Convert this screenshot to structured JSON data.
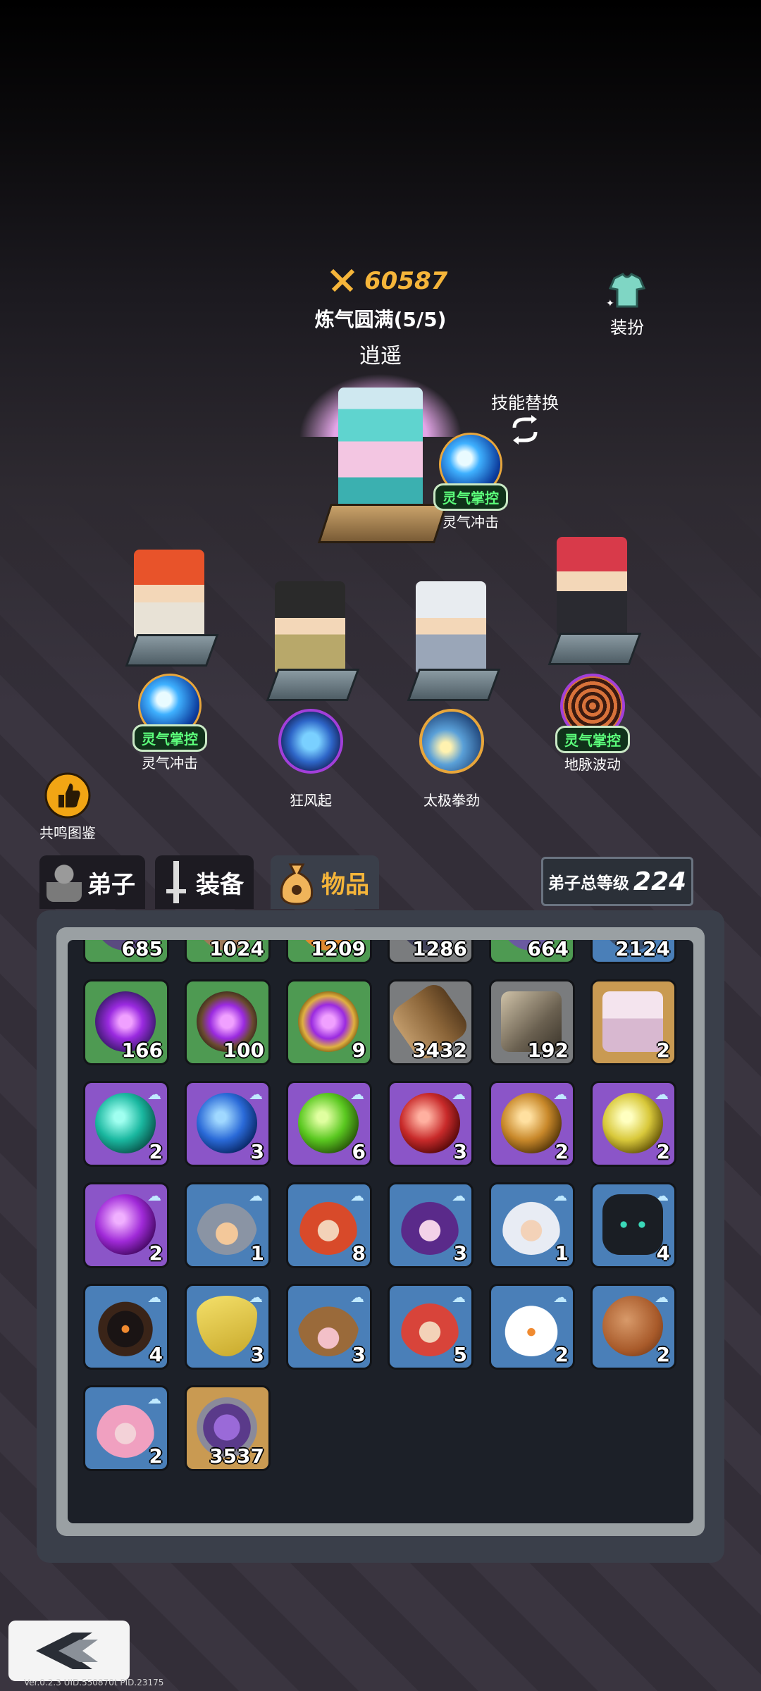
{
  "hero": {
    "power": "60587",
    "realm": "炼气圆满(5/5)",
    "name": "逍遥",
    "dress_label": "装扮",
    "skill_swap_label": "技能替换",
    "skill": {
      "badge": "灵气掌控",
      "name": "灵气冲击",
      "icon": "energy-orb-icon"
    }
  },
  "disciples": [
    {
      "skill_badge": "灵气掌控",
      "skill_name": "灵气冲击",
      "icon": "energy-orb-icon"
    },
    {
      "skill_badge": "",
      "skill_name": "狂风起",
      "icon": "tornado-icon"
    },
    {
      "skill_badge": "",
      "skill_name": "太极拳劲",
      "icon": "taiji-fist-icon"
    },
    {
      "skill_badge": "灵气掌控",
      "skill_name": "地脉波动",
      "icon": "earth-pulse-icon"
    }
  ],
  "codex_label": "共鸣图鉴",
  "tabs": [
    {
      "label": "弟子",
      "icon": "disciple-icon",
      "active": false
    },
    {
      "label": "装备",
      "icon": "sword-icon",
      "active": false
    },
    {
      "label": "物品",
      "icon": "bag-icon",
      "active": true
    }
  ],
  "level": {
    "label": "弟子总等级",
    "value": "224"
  },
  "inventory": {
    "row0": [
      "685",
      "1024",
      "1209",
      "1286",
      "664",
      "2124"
    ],
    "row1": [
      {
        "count": "166",
        "rarity": "green",
        "icon": "purple-orb-icon"
      },
      {
        "count": "100",
        "rarity": "green",
        "icon": "purple-orb-nest-icon"
      },
      {
        "count": "9",
        "rarity": "green",
        "icon": "purple-orb-gold-icon"
      },
      {
        "count": "3432",
        "rarity": "gray",
        "icon": "wood-log-icon"
      },
      {
        "count": "192",
        "rarity": "gray",
        "icon": "stone-icon"
      },
      {
        "count": "2",
        "rarity": "gold",
        "icon": "treasure-chest-icon"
      }
    ],
    "row2": [
      {
        "count": "2",
        "rarity": "purple",
        "icon": "teal-gourd-icon"
      },
      {
        "count": "3",
        "rarity": "purple",
        "icon": "blue-gourd-icon"
      },
      {
        "count": "6",
        "rarity": "purple",
        "icon": "green-gourd-icon"
      },
      {
        "count": "3",
        "rarity": "purple",
        "icon": "red-gourd-icon"
      },
      {
        "count": "2",
        "rarity": "purple",
        "icon": "amber-gourd-icon"
      },
      {
        "count": "2",
        "rarity": "purple",
        "icon": "yellow-gourd-icon"
      }
    ],
    "row3": [
      {
        "count": "2",
        "rarity": "purple",
        "icon": "violet-gourd-icon"
      },
      {
        "count": "1",
        "rarity": "blue",
        "icon": "hooded-disciple-icon"
      },
      {
        "count": "8",
        "rarity": "blue",
        "icon": "red-dragon-girl-icon"
      },
      {
        "count": "3",
        "rarity": "blue",
        "icon": "purple-hair-girl-icon"
      },
      {
        "count": "1",
        "rarity": "blue",
        "icon": "white-hair-boy-icon"
      },
      {
        "count": "4",
        "rarity": "blue",
        "icon": "shadow-creature-icon"
      }
    ],
    "row4": [
      {
        "count": "4",
        "rarity": "blue",
        "icon": "dark-hood-icon"
      },
      {
        "count": "3",
        "rarity": "blue",
        "icon": "banana-icon"
      },
      {
        "count": "3",
        "rarity": "blue",
        "icon": "witch-hat-icon"
      },
      {
        "count": "5",
        "rarity": "blue",
        "icon": "red-hair-girl-icon"
      },
      {
        "count": "2",
        "rarity": "blue",
        "icon": "white-duck-icon"
      },
      {
        "count": "2",
        "rarity": "blue",
        "icon": "basketball-icon"
      }
    ],
    "row5": [
      {
        "count": "2",
        "rarity": "blue",
        "icon": "flower-girl-icon"
      },
      {
        "count": "3537",
        "rarity": "gold",
        "icon": "purple-crystal-icon"
      }
    ]
  },
  "back_label": "back-arrow-icon",
  "version": "Ver.0.2.3    UID.550870t    PID.23175",
  "colors": {
    "gold": "#f5b53a",
    "badge_green": "#5cff7b",
    "panel": "#1c2028"
  }
}
